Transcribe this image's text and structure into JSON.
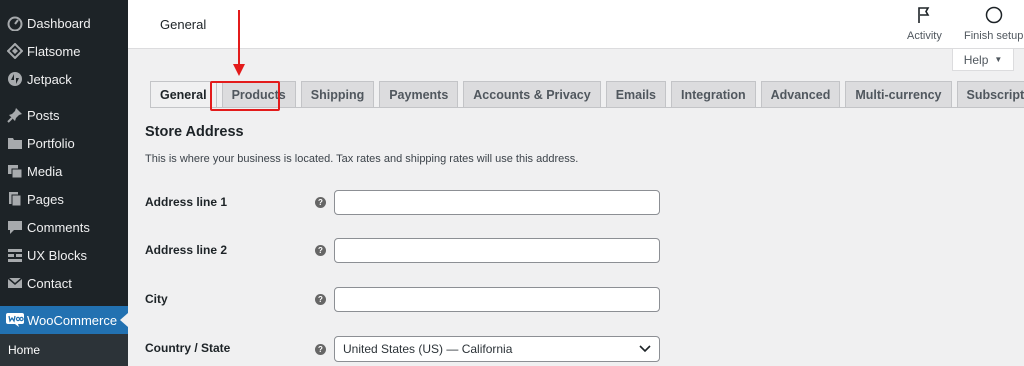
{
  "sidebar": {
    "items": [
      {
        "label": "Dashboard",
        "icon": "dashboard-icon"
      },
      {
        "label": "Flatsome",
        "icon": "flatsome-icon"
      },
      {
        "label": "Jetpack",
        "icon": "jetpack-icon"
      },
      {
        "label": "Posts",
        "icon": "pin-icon"
      },
      {
        "label": "Portfolio",
        "icon": "folder-icon"
      },
      {
        "label": "Media",
        "icon": "media-icon"
      },
      {
        "label": "Pages",
        "icon": "pages-icon"
      },
      {
        "label": "Comments",
        "icon": "comment-icon"
      },
      {
        "label": "UX Blocks",
        "icon": "blocks-icon"
      },
      {
        "label": "Contact",
        "icon": "mail-icon"
      },
      {
        "label": "WooCommerce",
        "icon": "woo-icon",
        "active": true
      }
    ],
    "submenu": {
      "label": "Home"
    }
  },
  "header": {
    "title": "General",
    "activity_label": "Activity",
    "finish_setup_label": "Finish setup"
  },
  "help": {
    "label": "Help",
    "caret": "▼"
  },
  "tabs": [
    {
      "label": "General",
      "active": true
    },
    {
      "label": "Products"
    },
    {
      "label": "Shipping"
    },
    {
      "label": "Payments"
    },
    {
      "label": "Accounts & Privacy"
    },
    {
      "label": "Emails"
    },
    {
      "label": "Integration"
    },
    {
      "label": "Advanced"
    },
    {
      "label": "Multi-currency"
    },
    {
      "label": "Subscriptions"
    }
  ],
  "form": {
    "section_title": "Store Address",
    "section_desc": "This is where your business is located. Tax rates and shipping rates will use this address.",
    "help_glyph": "?",
    "fields": [
      {
        "label": "Address line 1",
        "value": ""
      },
      {
        "label": "Address line 2",
        "value": ""
      },
      {
        "label": "City",
        "value": ""
      },
      {
        "label": "Country / State",
        "value": "United States (US) — California"
      }
    ]
  },
  "colors": {
    "sidebar_bg": "#1d2327",
    "accent": "#2271b1",
    "highlight": "#e31b1b"
  }
}
